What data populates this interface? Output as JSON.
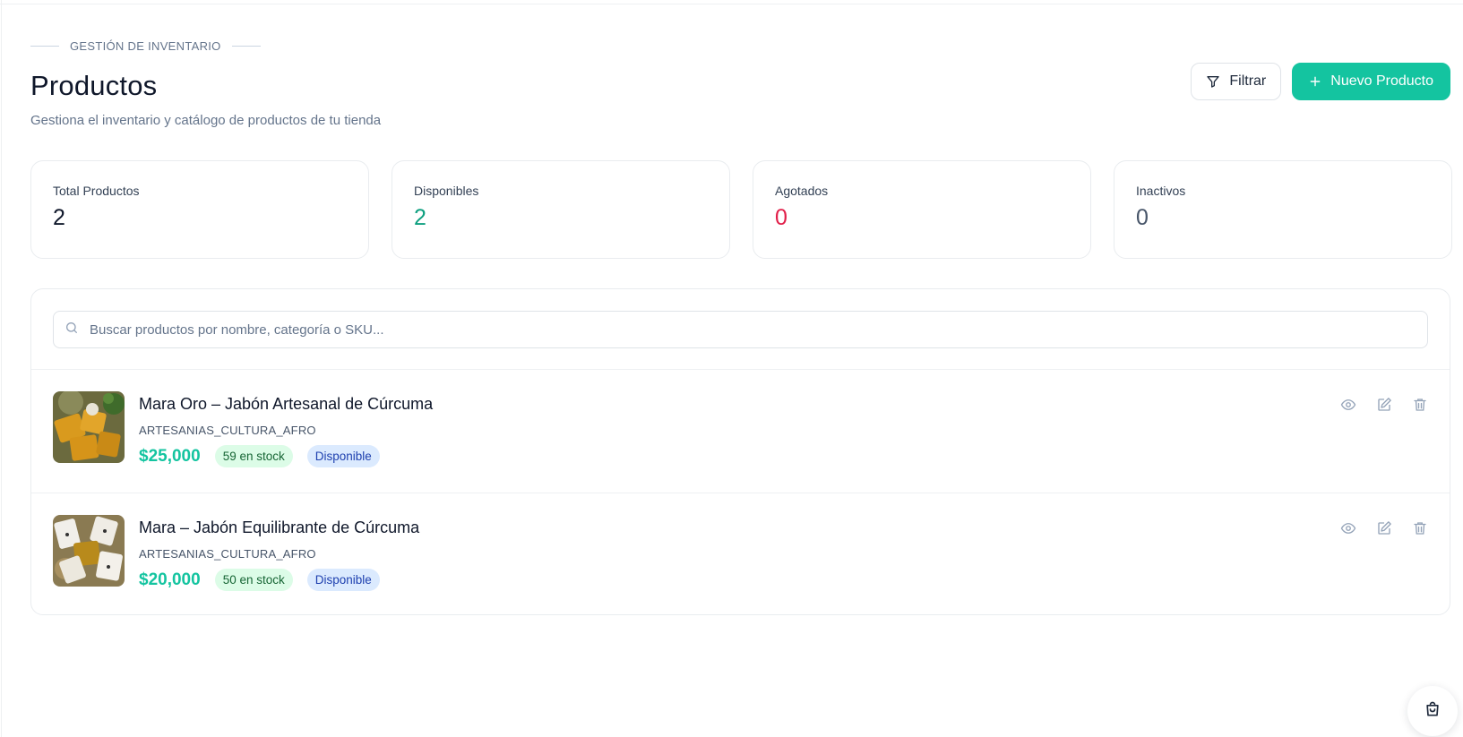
{
  "header": {
    "eyebrow": "GESTIÓN DE INVENTARIO",
    "title": "Productos",
    "subtitle": "Gestiona el inventario y catálogo de productos de tu tienda",
    "filter_label": "Filtrar",
    "new_label": "Nuevo Producto"
  },
  "stats": [
    {
      "label": "Total Productos",
      "value": "2",
      "color": "#0f172a"
    },
    {
      "label": "Disponibles",
      "value": "2",
      "color": "#0d9f7f"
    },
    {
      "label": "Agotados",
      "value": "0",
      "color": "#e11d48"
    },
    {
      "label": "Inactivos",
      "value": "0",
      "color": "#475569"
    }
  ],
  "search": {
    "placeholder": "Buscar productos por nombre, categoría o SKU...",
    "value": ""
  },
  "products": [
    {
      "name": "Mara Oro – Jabón Artesanal de Cúrcuma",
      "category": "ARTESANIAS_CULTURA_AFRO",
      "price": "$25,000",
      "stock": "59 en stock",
      "status": "Disponible"
    },
    {
      "name": "Mara – Jabón Equilibrante de Cúrcuma",
      "category": "ARTESANIAS_CULTURA_AFRO",
      "price": "$20,000",
      "stock": "50 en stock",
      "status": "Disponible"
    }
  ],
  "icons": {
    "filter": "filter-icon",
    "plus": "plus-icon",
    "search": "search-icon",
    "view": "eye-icon",
    "edit": "edit-icon",
    "delete": "trash-icon",
    "cart": "shopping-bag-icon"
  },
  "colors": {
    "accent": "#14c4a0",
    "stock_badge_bg": "#dcfce7",
    "status_badge_bg": "#dbeafe"
  }
}
